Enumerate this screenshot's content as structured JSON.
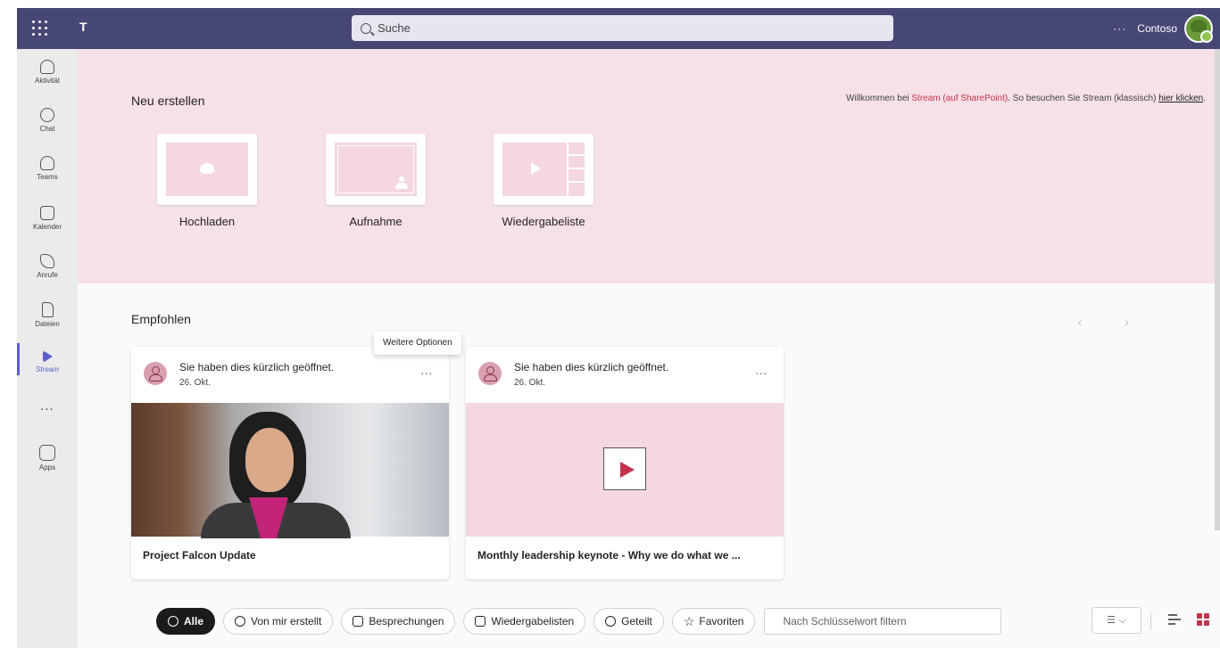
{
  "topbar": {
    "search_placeholder": "Suche",
    "more": "···",
    "org": "Contoso"
  },
  "rail": {
    "items": [
      {
        "label": "Aktivität",
        "icon": "bell-icon"
      },
      {
        "label": "Chat",
        "icon": "chat-icon"
      },
      {
        "label": "Teams",
        "icon": "teams-icon"
      },
      {
        "label": "Kalender",
        "icon": "calendar-icon"
      },
      {
        "label": "Anrufe",
        "icon": "phone-icon"
      },
      {
        "label": "Dateien",
        "icon": "file-icon"
      },
      {
        "label": "Stream",
        "icon": "stream-icon"
      },
      {
        "label": "Apps",
        "icon": "apps-icon"
      }
    ],
    "more": "···",
    "active": "Stream",
    "active_color": "#5b5fc7"
  },
  "hero": {
    "title": "Neu erstellen",
    "welcome_prefix": "Willkommen bei ",
    "welcome_link": "Stream (auf SharePoint)",
    "welcome_mid": ". So besuchen Sie Stream (klassisch) ",
    "welcome_click": "hier klicken",
    "welcome_end": ".",
    "tiles": [
      {
        "label": "Hochladen",
        "icon": "upload-cloud-icon"
      },
      {
        "label": "Aufnahme",
        "icon": "record-icon"
      },
      {
        "label": "Wiedergabeliste",
        "icon": "playlist-icon"
      }
    ],
    "background": "#f6e1e7"
  },
  "recommended": {
    "title": "Empfohlen",
    "nav": "‹ ›",
    "tooltip": "Weitere Optionen",
    "cards": [
      {
        "activity": "Sie haben dies kürzlich geöffnet.",
        "date": "26. Okt.",
        "more": "···",
        "title": "Project Falcon Update"
      },
      {
        "activity": "Sie haben dies kürzlich geöffnet.",
        "date": "26. Okt.",
        "more": "···",
        "title": "Monthly leadership keynote - Why we do what we ..."
      }
    ]
  },
  "filters": {
    "pills": [
      "Alle",
      "Von mir erstellt",
      "Besprechungen",
      "Wiedergabelisten",
      "Geteilt",
      "Favoriten"
    ],
    "active": "Alle",
    "keyword_placeholder": "Nach Schlüsselwort filtern",
    "sort": "☰ ⌵",
    "accent": "#c4314b"
  }
}
